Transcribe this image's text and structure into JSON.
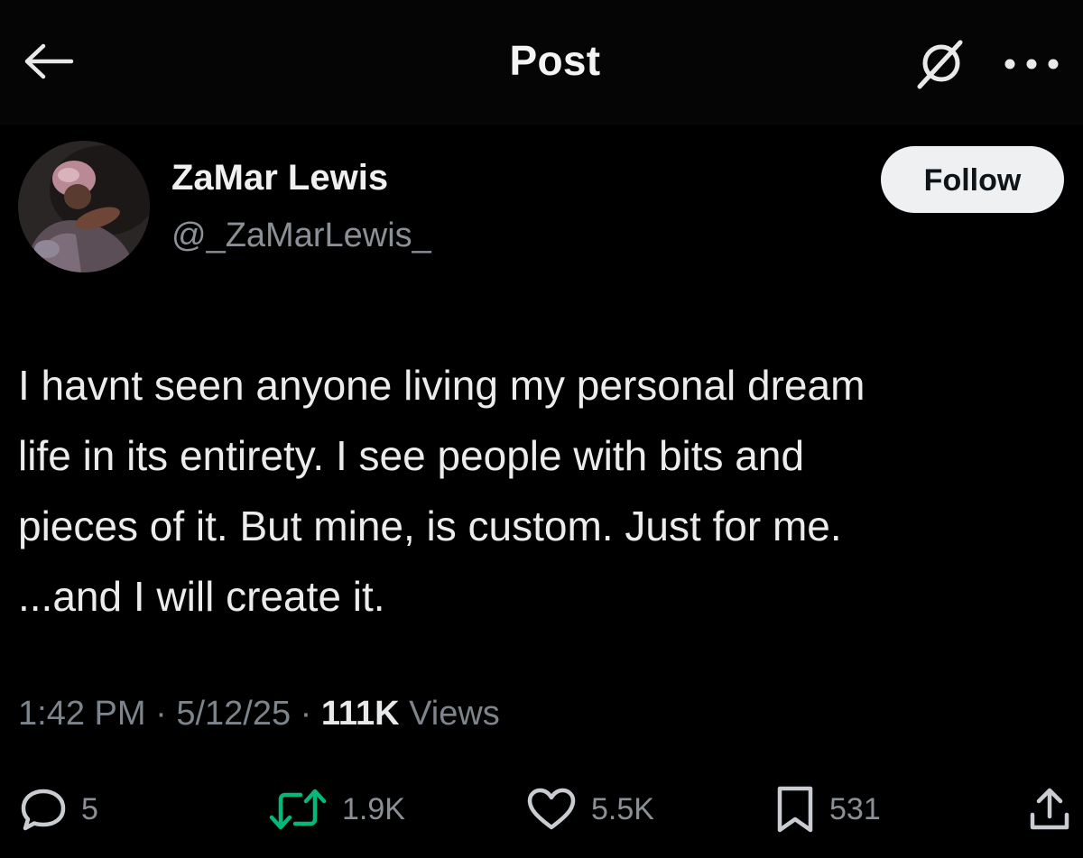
{
  "header": {
    "title": "Post",
    "back_icon": "arrow-left-icon",
    "grok_icon": "grok-icon",
    "more_icon": "more-horizontal-icon"
  },
  "author": {
    "name": "ZaMar Lewis",
    "handle": "@_ZaMarLewis_",
    "follow_label": "Follow"
  },
  "post": {
    "lines": [
      "I havnt seen anyone living my personal dream",
      "life in its entirety. I see people with bits and",
      "pieces of it. But mine, is custom. Just for me.",
      "...and I will create it."
    ]
  },
  "meta": {
    "time": "1:42 PM",
    "separator": " · ",
    "date": "5/12/25",
    "views_count": "111K",
    "views_label": " Views"
  },
  "actions": {
    "replies": "5",
    "reposts": "1.9K",
    "likes": "5.5K",
    "bookmarks": "531",
    "repost_color": "#00ba7c"
  },
  "colors": {
    "background": "#000000",
    "text_primary": "#e7e9ea",
    "text_secondary": "#8b9096",
    "follow_bg": "#eef0f1"
  }
}
